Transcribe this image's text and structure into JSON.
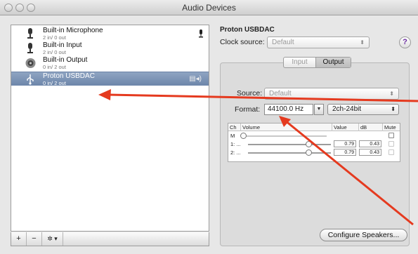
{
  "window": {
    "title": "Audio Devices"
  },
  "devices": [
    {
      "name": "Built-in Microphone",
      "sub": "2 in/ 0 out",
      "icon": "microphone-icon"
    },
    {
      "name": "Built-in Input",
      "sub": "2 in/ 0 out",
      "icon": "microphone-icon"
    },
    {
      "name": "Built-in Output",
      "sub": "0 in/ 2 out",
      "icon": "speaker-icon"
    },
    {
      "name": "Proton USBDAC",
      "sub": "0 in/ 2 out",
      "icon": "usb-icon",
      "selected": true
    }
  ],
  "list_toolbar": {
    "add": "+",
    "remove": "−",
    "gear": "✲ ▾"
  },
  "detail": {
    "device_title": "Proton USBDAC",
    "clock_label": "Clock source:",
    "clock_value": "Default",
    "help": "?",
    "tabs": [
      "Input",
      "Output"
    ],
    "active_tab": "Output",
    "source_label": "Source:",
    "source_value": "Default",
    "format_label": "Format:",
    "format_rate": "44100.0 Hz",
    "format_bits": "2ch-24bit",
    "table": {
      "headers": [
        "Ch",
        "Volume",
        "Value",
        "dB",
        "Mute"
      ],
      "rows": [
        {
          "ch": "M",
          "value": "",
          "db": ""
        },
        {
          "ch": "1: ...",
          "value": "0.79",
          "db": "0.43"
        },
        {
          "ch": "2: ...",
          "value": "0.79",
          "db": "0.43"
        }
      ]
    },
    "configure_button": "Configure Speakers..."
  },
  "colors": {
    "selection": "#7a90b2",
    "annotation_arrow": "#e53a1f"
  }
}
